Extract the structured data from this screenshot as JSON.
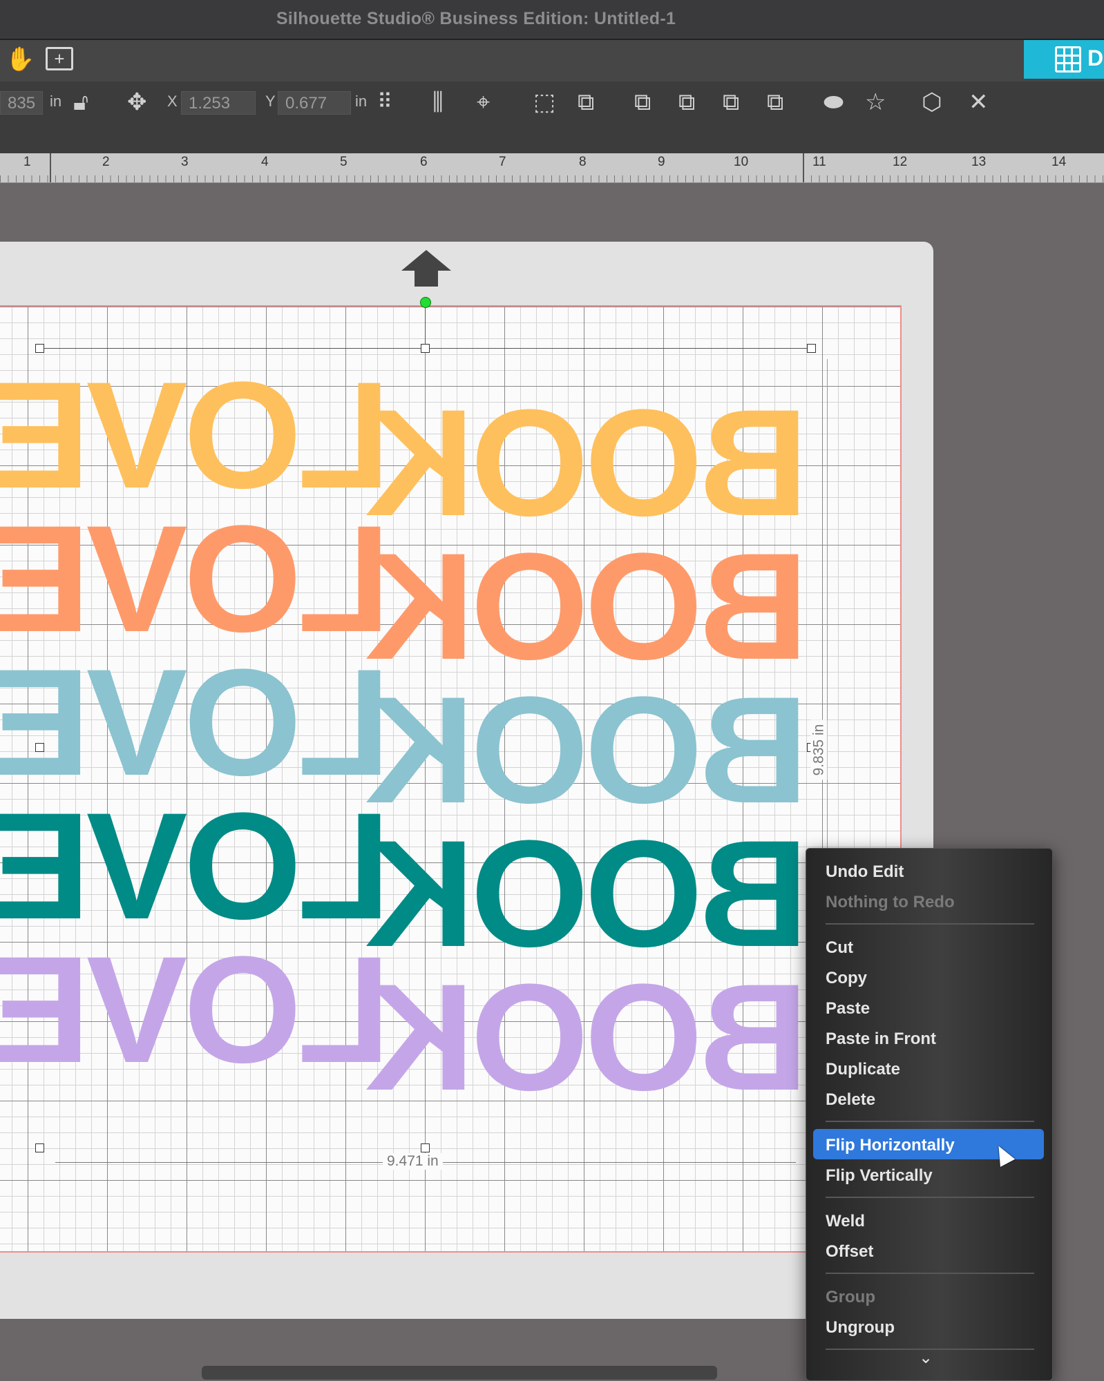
{
  "window": {
    "title": "Silhouette Studio® Business Edition: Untitled-1"
  },
  "toolbar_top": {
    "icons": [
      "hand-icon",
      "zoom-fit-icon"
    ],
    "design_tab_label": "D"
  },
  "toolbar_transform": {
    "width_value": "835",
    "width_unit": "in",
    "x_label": "X",
    "x_value": "1.253",
    "y_label": "Y",
    "y_value": "0.677",
    "pos_unit": "in"
  },
  "ruler": {
    "numbers": [
      "1",
      "2",
      "3",
      "4",
      "5",
      "6",
      "7",
      "8",
      "9",
      "10",
      "11",
      "12",
      "13",
      "14"
    ]
  },
  "canvas": {
    "words": [
      {
        "w1": "LOVER",
        "w2": "BOOK",
        "color": "#fec05c"
      },
      {
        "w1": "LOVER",
        "w2": "BOOK",
        "color": "#fe9a6a"
      },
      {
        "w1": "LOVER",
        "w2": "BOOK",
        "color": "#8bc3d0"
      },
      {
        "w1": "LOVER",
        "w2": "BOOK",
        "color": "#008b86"
      },
      {
        "w1": "LOVER",
        "w2": "BOOK",
        "color": "#c4a6e8"
      }
    ],
    "width_dim": "9.471 in",
    "height_dim": "9.835 in"
  },
  "context_menu": {
    "undo": "Undo Edit",
    "redo": "Nothing to Redo",
    "cut": "Cut",
    "copy": "Copy",
    "paste": "Paste",
    "paste_front": "Paste in Front",
    "duplicate": "Duplicate",
    "delete": "Delete",
    "flip_h": "Flip Horizontally",
    "flip_v": "Flip Vertically",
    "weld": "Weld",
    "offset": "Offset",
    "group": "Group",
    "ungroup": "Ungroup"
  },
  "colors": {
    "accent": "#1fb8d6",
    "menu_highlight": "#2f78dc"
  }
}
